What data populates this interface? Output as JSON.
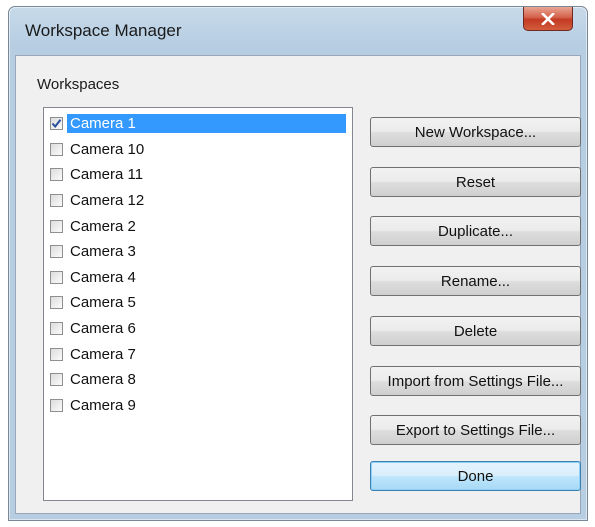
{
  "window": {
    "title": "Workspace Manager",
    "close_icon": "close-x-icon"
  },
  "workspaces": {
    "label": "Workspaces",
    "items": [
      {
        "label": "Camera 1",
        "checked": true,
        "selected": true
      },
      {
        "label": "Camera 10",
        "checked": false,
        "selected": false
      },
      {
        "label": "Camera 11",
        "checked": false,
        "selected": false
      },
      {
        "label": "Camera 12",
        "checked": false,
        "selected": false
      },
      {
        "label": "Camera 2",
        "checked": false,
        "selected": false
      },
      {
        "label": "Camera 3",
        "checked": false,
        "selected": false
      },
      {
        "label": "Camera 4",
        "checked": false,
        "selected": false
      },
      {
        "label": "Camera 5",
        "checked": false,
        "selected": false
      },
      {
        "label": "Camera 6",
        "checked": false,
        "selected": false
      },
      {
        "label": "Camera 7",
        "checked": false,
        "selected": false
      },
      {
        "label": "Camera 8",
        "checked": false,
        "selected": false
      },
      {
        "label": "Camera 9",
        "checked": false,
        "selected": false
      }
    ]
  },
  "buttons": {
    "new_workspace": "New Workspace...",
    "reset": "Reset",
    "duplicate": "Duplicate...",
    "rename": "Rename...",
    "delete": "Delete",
    "import": "Import from Settings File...",
    "export": "Export to Settings File...",
    "done": "Done"
  },
  "colors": {
    "selection": "#3399ff",
    "check_mark": "#2a4e9c",
    "close_button": "#c9452e"
  }
}
